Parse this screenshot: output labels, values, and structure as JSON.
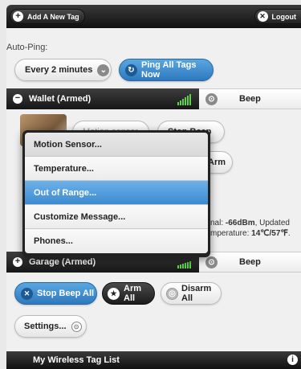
{
  "toolbar": {
    "add_tag_label": "Add A New Tag",
    "logout_label": "Logout"
  },
  "autoping": {
    "label": "Auto-Ping:",
    "interval_value": "Every 2 minutes",
    "ping_all_label": "Ping All Tags Now"
  },
  "tags": [
    {
      "name": "Wallet (Armed)",
      "beep_label": "Beep",
      "partial_button_1": "Motion sensor",
      "partial_button_2": "Stop Beep",
      "partial_button_3": "Arm",
      "info_line_1_prefix": "nal: ",
      "info_signal": "-66dBm",
      "info_line_1_suffix": ", Updated",
      "info_line_2_prefix": "mperature: ",
      "info_temp": "14℃/57℉",
      "info_line_2_suffix": "."
    },
    {
      "name": "Garage (Armed)",
      "beep_label": "Beep"
    }
  ],
  "menu": {
    "items": [
      "Motion Sensor...",
      "Temperature...",
      "Out of Range...",
      "Customize Message...",
      "Phones..."
    ],
    "selected_index": 2
  },
  "actions": {
    "stop_beep_all": "Stop Beep All",
    "arm_all": "Arm All",
    "disarm_all": "Disarm All",
    "settings": "Settings..."
  },
  "footer": {
    "title": "My Wireless Tag List",
    "info_icon": "i"
  },
  "colors": {
    "accent_blue": "#3d8ad0",
    "signal_green": "#5fd14a",
    "dark_bar": "#1a1a1a"
  },
  "icons": [
    "plus-icon",
    "close-icon",
    "chevron-down-icon",
    "refresh-icon",
    "minus-icon",
    "signal-icon",
    "search-icon",
    "info-icon"
  ]
}
